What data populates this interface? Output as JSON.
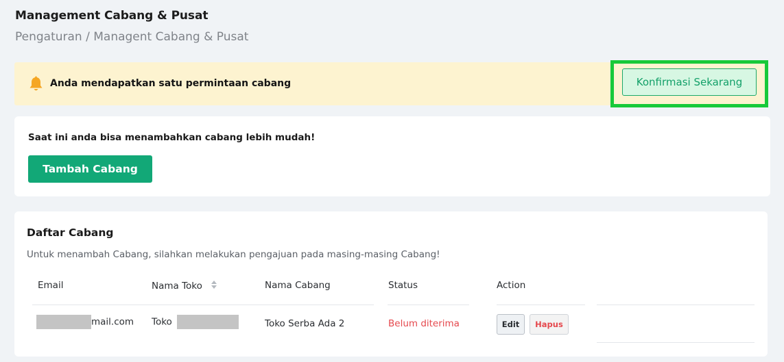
{
  "header": {
    "title": "Management Cabang & Pusat",
    "breadcrumb": "Pengaturan / Managent Cabang & Pusat"
  },
  "notice": {
    "icon": "bell-icon",
    "message": "Anda mendapatkan satu permintaan cabang",
    "confirm_label": "Konfirmasi Sekarang",
    "highlight_color": "#18c93a",
    "background": "#fdf3d0"
  },
  "add_branch": {
    "info": "Saat ini anda bisa menambahkan cabang lebih mudah!",
    "button_label": "Tambah Cabang",
    "button_color": "#12a877"
  },
  "branch_list": {
    "title": "Daftar Cabang",
    "subtitle": "Untuk menambah Cabang, silahkan melakukan pengajuan pada masing-masing Cabang!",
    "columns": [
      "Email",
      "Nama Toko",
      "Nama Cabang",
      "Status",
      "Action"
    ],
    "rows": [
      {
        "email_suffix": "mail.com",
        "store_prefix": "Toko",
        "branch": "Toko Serba Ada 2",
        "status": "Belum diterima",
        "edit_label": "Edit",
        "delete_label": "Hapus"
      }
    ]
  }
}
